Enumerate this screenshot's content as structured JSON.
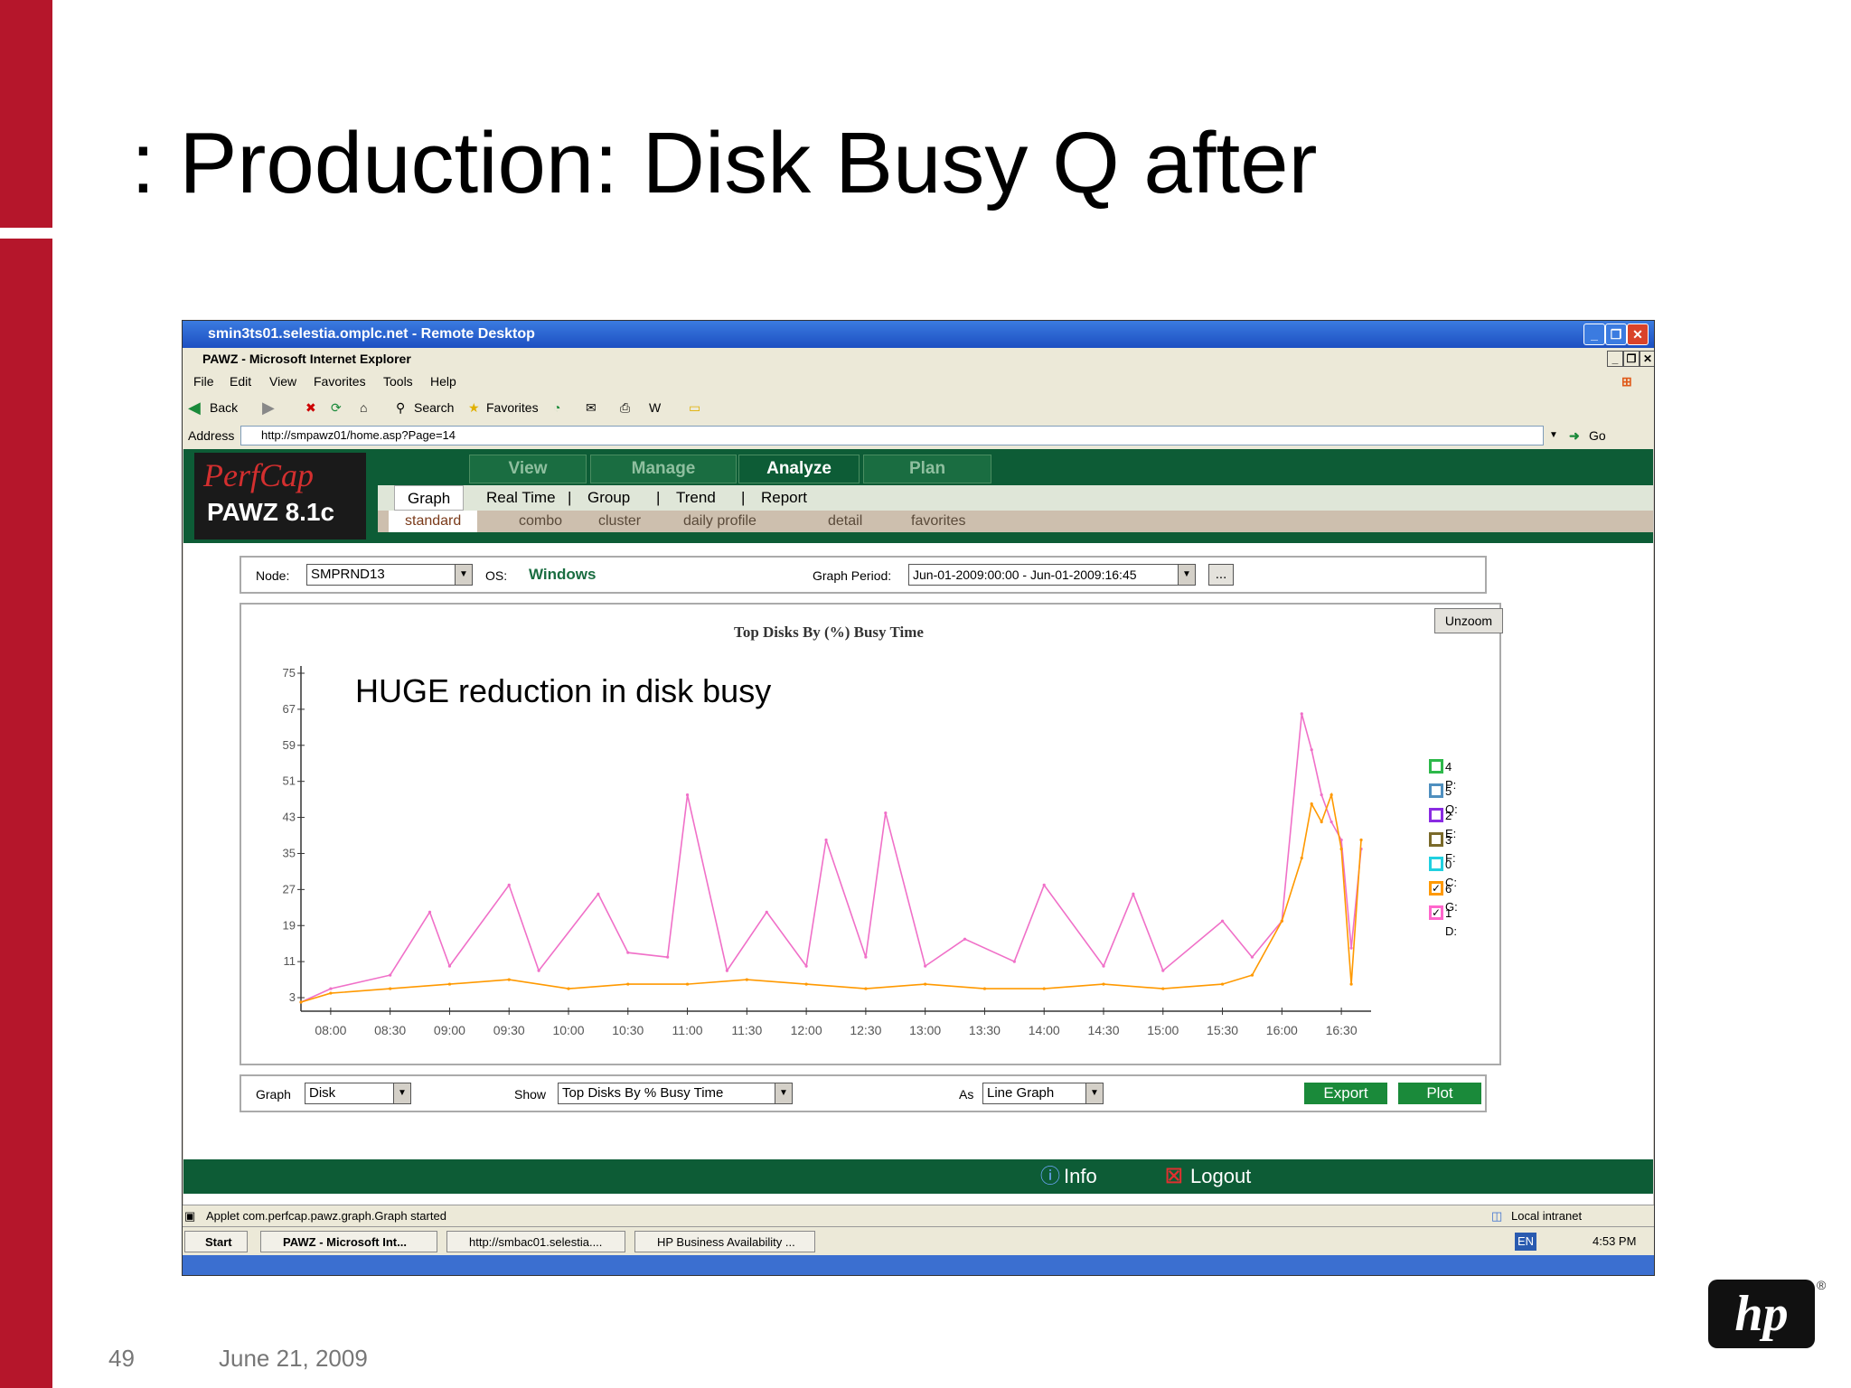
{
  "slide": {
    "title": ": Production: Disk Busy Q after",
    "page_number": "49",
    "date": "June 21, 2009",
    "logo_text": "hp"
  },
  "remote_desktop": {
    "title": "smin3ts01.selestia.omplc.net - Remote Desktop"
  },
  "browser": {
    "title": "PAWZ - Microsoft Internet Explorer",
    "menu": [
      "File",
      "Edit",
      "View",
      "Favorites",
      "Tools",
      "Help"
    ],
    "toolbar": {
      "back": "Back",
      "search": "Search",
      "favorites": "Favorites"
    },
    "address_label": "Address",
    "address_value": "http://smpawz01/home.asp?Page=14",
    "go_label": "Go",
    "status_text": "Applet com.perfcap.pawz.graph.Graph started",
    "zone": "Local intranet"
  },
  "app": {
    "brand": "PerfCap",
    "product": "PAWZ 8.1c",
    "tabs": [
      "View",
      "Manage",
      "Analyze",
      "Plan"
    ],
    "active_tab": "Analyze",
    "subnav": [
      "Graph",
      "Real Time",
      "Group",
      "Trend",
      "Report"
    ],
    "subnav_sep": "|",
    "subnav2": [
      "standard",
      "combo",
      "cluster",
      "daily profile",
      "detail",
      "favorites"
    ],
    "node_label": "Node:",
    "node_value": "SMPRND13",
    "os_label": "OS:",
    "os_value": "Windows",
    "period_label": "Graph Period:",
    "period_value": "Jun-01-2009:00:00 - Jun-01-2009:16:45",
    "period_btn": "...",
    "unzoom": "Unzoom",
    "graph_label": "Graph",
    "graph_value": "Disk",
    "show_label": "Show",
    "show_value": "Top Disks By % Busy Time",
    "as_label": "As",
    "as_value": "Line Graph",
    "export": "Export",
    "plot": "Plot",
    "info": "Info",
    "logout": "Logout"
  },
  "taskbar": {
    "start": "Start",
    "items": [
      "PAWZ - Microsoft Int...",
      "http://smbac01.selestia....",
      "HP Business Availability ..."
    ],
    "lang": "EN",
    "time": "4:53 PM"
  },
  "chart_data": {
    "type": "line",
    "title": "Top Disks By (%) Busy Time",
    "annotation": "HUGE reduction in disk busy",
    "xlabel": "",
    "ylabel": "",
    "ylim": [
      0,
      75
    ],
    "yticks": [
      3,
      11,
      19,
      27,
      35,
      43,
      51,
      59,
      67,
      75
    ],
    "xlim": [
      "07:45",
      "16:45"
    ],
    "xticks": [
      "08:00",
      "08:30",
      "09:00",
      "09:30",
      "10:00",
      "10:30",
      "11:00",
      "11:30",
      "12:00",
      "12:30",
      "13:00",
      "13:30",
      "14:00",
      "14:30",
      "15:00",
      "15:30",
      "16:00",
      "16:30"
    ],
    "legend_position": "right",
    "legend": [
      {
        "name": "4 P:",
        "color": "#2db84a",
        "checked": false
      },
      {
        "name": "5 Q:",
        "color": "#4f8fbf",
        "checked": false
      },
      {
        "name": "2 E:",
        "color": "#8a2be2",
        "checked": false
      },
      {
        "name": "3 F:",
        "color": "#7a6a2a",
        "checked": false
      },
      {
        "name": "0 C:",
        "color": "#20d0e0",
        "checked": false
      },
      {
        "name": "6 G:",
        "color": "#ff9900",
        "checked": true
      },
      {
        "name": "1 D:",
        "color": "#ff66cc",
        "checked": true
      }
    ],
    "series": [
      {
        "name": "1 D:",
        "color": "#f070c8",
        "x": [
          "07:45",
          "08:00",
          "08:30",
          "08:50",
          "09:00",
          "09:30",
          "09:45",
          "10:15",
          "10:30",
          "10:50",
          "11:00",
          "11:20",
          "11:40",
          "12:00",
          "12:10",
          "12:30",
          "12:40",
          "13:00",
          "13:20",
          "13:45",
          "14:00",
          "14:30",
          "14:45",
          "15:00",
          "15:30",
          "15:45",
          "16:00",
          "16:10",
          "16:15",
          "16:20",
          "16:25",
          "16:30",
          "16:35",
          "16:40"
        ],
        "y": [
          2,
          5,
          8,
          22,
          10,
          28,
          9,
          26,
          13,
          12,
          48,
          9,
          22,
          10,
          38,
          12,
          44,
          10,
          16,
          11,
          28,
          10,
          26,
          9,
          20,
          12,
          20,
          66,
          58,
          48,
          42,
          38,
          14,
          36
        ]
      },
      {
        "name": "6 G:",
        "color": "#ff9900",
        "x": [
          "07:45",
          "08:00",
          "08:30",
          "09:00",
          "09:30",
          "10:00",
          "10:30",
          "11:00",
          "11:30",
          "12:00",
          "12:30",
          "13:00",
          "13:30",
          "14:00",
          "14:30",
          "15:00",
          "15:30",
          "15:45",
          "16:00",
          "16:10",
          "16:15",
          "16:20",
          "16:25",
          "16:30",
          "16:35",
          "16:40"
        ],
        "y": [
          2,
          4,
          5,
          6,
          7,
          5,
          6,
          6,
          7,
          6,
          5,
          6,
          5,
          5,
          6,
          5,
          6,
          8,
          20,
          34,
          46,
          42,
          48,
          36,
          6,
          38
        ]
      }
    ]
  }
}
